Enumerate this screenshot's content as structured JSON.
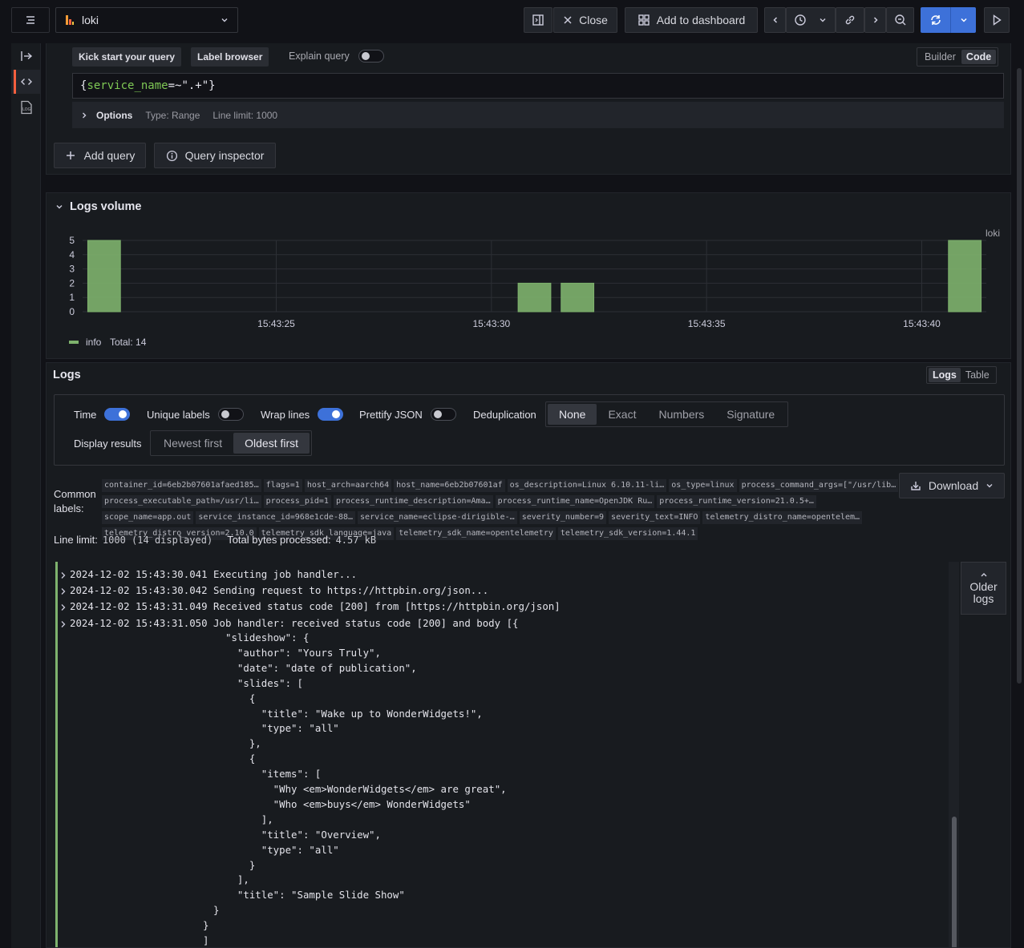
{
  "topbar": {
    "datasource": "loki",
    "close_label": "Close",
    "add_dashboard_label": "Add to dashboard"
  },
  "query": {
    "kick_start_label": "Kick start your query",
    "label_browser_label": "Label browser",
    "explain_label": "Explain query",
    "builder_label": "Builder",
    "code_label": "Code",
    "expression_parts": [
      "{",
      "service_name",
      "=~",
      "\".+\"",
      "}"
    ],
    "options_label": "Options",
    "options_type": "Type: Range",
    "options_limit": "Line limit: 1000",
    "add_query_label": "Add query",
    "inspector_label": "Query inspector"
  },
  "volume": {
    "title": "Logs volume",
    "series_label": "loki",
    "legend_name": "info",
    "legend_total": "Total: 14"
  },
  "chart_data": {
    "type": "bar",
    "title": "Logs volume",
    "x_ticks": [
      "15:43:25",
      "15:43:30",
      "15:43:35",
      "15:43:40"
    ],
    "x": [
      "15:43:21",
      "15:43:31",
      "15:43:32",
      "15:43:41"
    ],
    "series": [
      {
        "name": "info",
        "values": [
          5,
          2,
          2,
          5
        ],
        "color": "#7eb26d"
      }
    ],
    "y_ticks": [
      0,
      1,
      2,
      3,
      4,
      5
    ],
    "ylim": [
      0,
      5
    ],
    "grid": true,
    "legend": "bottom-left"
  },
  "logs": {
    "title": "Logs",
    "view_tabs": [
      "Logs",
      "Table"
    ],
    "toggles": {
      "time": "Time",
      "unique_labels": "Unique labels",
      "wrap_lines": "Wrap lines",
      "prettify": "Prettify JSON",
      "dedup": "Deduplication"
    },
    "dedup_options": [
      "None",
      "Exact",
      "Numbers",
      "Signature"
    ],
    "display_results_label": "Display results",
    "order_options": [
      "Newest first",
      "Oldest first"
    ],
    "common_labels_title": "Common labels:",
    "common_labels": [
      "container_id=6eb2b07601afaed185…",
      "flags=1",
      "host_arch=aarch64",
      "host_name=6eb2b07601af",
      "os_description=Linux 6.10.11-li…",
      "os_type=linux",
      "process_command_args=[\"/usr/lib…",
      "process_executable_path=/usr/li…",
      "process_pid=1",
      "process_runtime_description=Ama…",
      "process_runtime_name=OpenJDK Ru…",
      "process_runtime_version=21.0.5+…",
      "scope_name=app.out",
      "service_instance_id=968e1cde-88…",
      "service_name=eclipse-dirigible-…",
      "severity_number=9",
      "severity_text=INFO",
      "telemetry_distro_name=opentelem…",
      "telemetry_distro_version=2.10.0",
      "telemetry_sdk_language=java",
      "telemetry_sdk_name=opentelemetry",
      "telemetry_sdk_version=1.44.1"
    ],
    "download_label": "Download",
    "line_limit_label": "Line limit:",
    "line_limit_value": "1000 (14 displayed)",
    "bytes_label": "Total bytes processed:",
    "bytes_value": "4.57 kB",
    "older_logs_label": "Older logs",
    "lines": [
      "2024-12-02 15:43:30.041 Executing job handler...",
      "2024-12-02 15:43:30.042 Sending request to https://httpbin.org/json...",
      "2024-12-02 15:43:31.049 Received status code [200] from [https://httpbin.org/json]",
      "2024-12-02 15:43:31.050 Job handler: received status code [200] and body [{"
    ],
    "body_lines": [
      "\"slideshow\": {",
      "  \"author\": \"Yours Truly\",",
      "  \"date\": \"date of publication\",",
      "  \"slides\": [",
      "    {",
      "      \"title\": \"Wake up to WonderWidgets!\",",
      "      \"type\": \"all\"",
      "    },",
      "    {",
      "      \"items\": [",
      "        \"Why <em>WonderWidgets</em> are great\",",
      "        \"Who <em>buys</em> WonderWidgets\"",
      "      ],",
      "      \"title\": \"Overview\",",
      "      \"type\": \"all\"",
      "    }",
      "  ],",
      "  \"title\": \"Sample Slide Show\"",
      "}",
      "}",
      "]"
    ]
  }
}
